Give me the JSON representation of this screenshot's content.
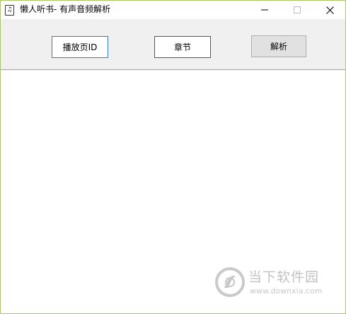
{
  "window": {
    "title": "懒人听书- 有声音频解析",
    "app_icon_glyph": "♫",
    "controls": {
      "minimize": "minimize-icon",
      "maximize": "maximize-icon",
      "close": "close-icon"
    }
  },
  "toolbar": {
    "page_id_label": "播放页ID",
    "chapter_label": "章节",
    "parse_label": "解析"
  },
  "watermark": {
    "title": "当下软件园",
    "url": "www.downxia.com"
  },
  "colors": {
    "window_border": "#a9c86a",
    "toolbar_bg": "#f0f0f0",
    "focus_border": "#2f7cc4"
  }
}
